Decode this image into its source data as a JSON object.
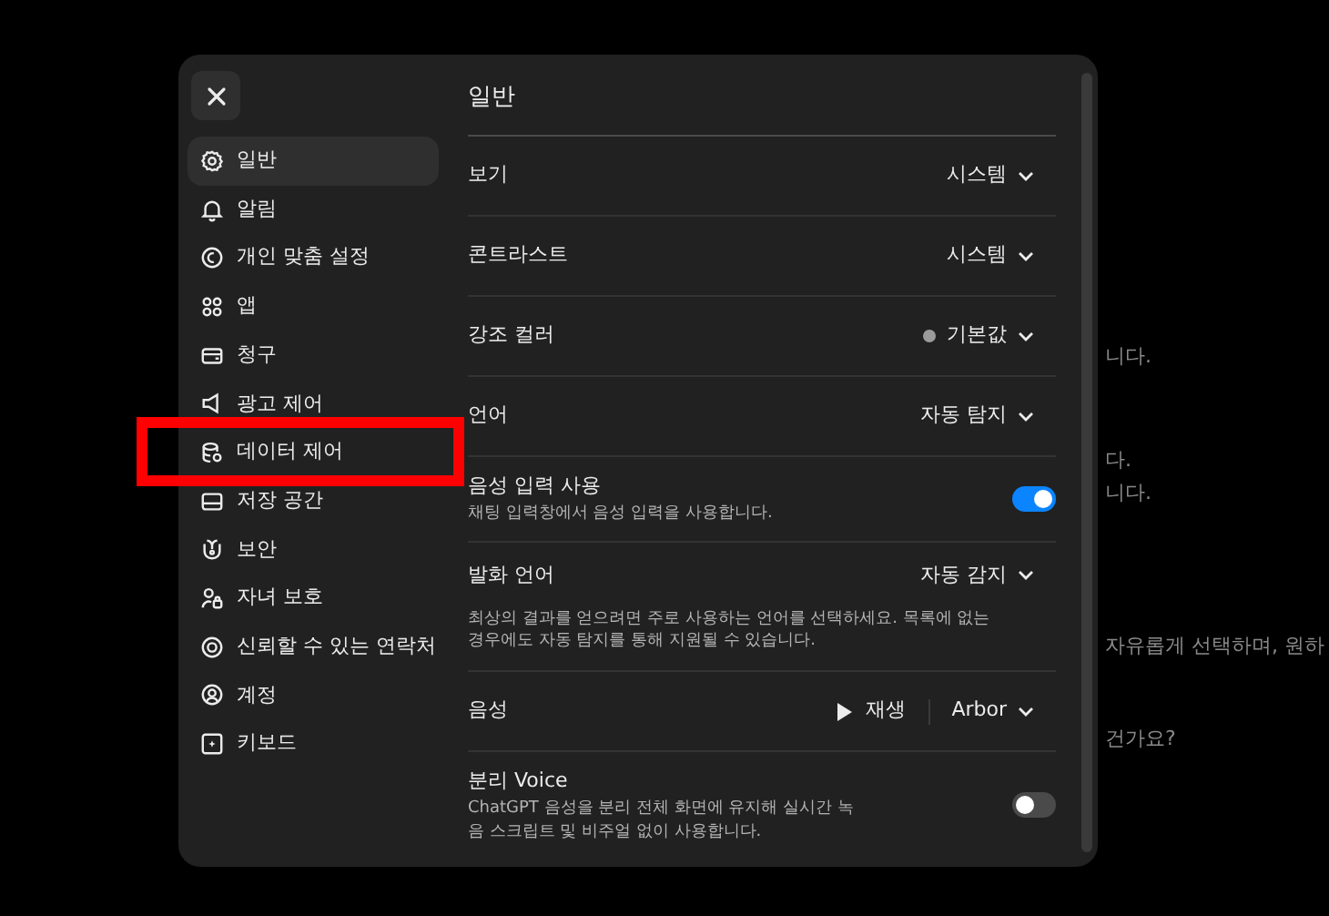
{
  "background_text": [
    "니다.",
    "다.",
    "니다.",
    "자유롭게 선택하며, 원하",
    "건가요?"
  ],
  "sidebar": {
    "items": [
      {
        "label": "일반",
        "selected": true
      },
      {
        "label": "알림",
        "selected": false
      },
      {
        "label": "개인 맞춤 설정",
        "selected": false
      },
      {
        "label": "앱",
        "selected": false
      },
      {
        "label": "청구",
        "selected": false
      },
      {
        "label": "광고 제어",
        "selected": false
      },
      {
        "label": "데이터 제어",
        "selected": false
      },
      {
        "label": "저장 공간",
        "selected": false
      },
      {
        "label": "보안",
        "selected": false
      },
      {
        "label": "자녀 보호",
        "selected": false
      },
      {
        "label": "신뢰할 수 있는 연락처",
        "selected": false
      },
      {
        "label": "계정",
        "selected": false
      },
      {
        "label": "키보드",
        "selected": false
      }
    ]
  },
  "panel": {
    "title": "일반",
    "rows": [
      {
        "kind": "select",
        "label": "보기",
        "value": "시스템"
      },
      {
        "kind": "select",
        "label": "콘트라스트",
        "value": "시스템"
      },
      {
        "kind": "select",
        "label": "강조 컬러",
        "value": "기본값",
        "color": "#9b9b9b"
      },
      {
        "kind": "select",
        "label": "언어",
        "value": "자동 탐지"
      },
      {
        "kind": "toggle",
        "label": "음성 입력 사용",
        "description": "채팅 입력창에서 음성 입력을 사용합니다.",
        "on": true
      },
      {
        "kind": "select",
        "label": "발화 언어",
        "value": "자동 감지",
        "description": "최상의 결과를 얻으려면 주로 사용하는 언어를 선택하세요. 목록에 없는 경우에도 자동 탐지를 통해 지원될 수 있습니다."
      },
      {
        "kind": "voice",
        "label": "음성",
        "play": "재생",
        "value": "Arbor"
      },
      {
        "kind": "toggle",
        "label": "분리 Voice",
        "description": "ChatGPT 음성을 분리 전체 화면에 유지해 실시간 녹음 스크립트 및 비주얼 없이 사용합니다.",
        "on": false
      }
    ]
  }
}
